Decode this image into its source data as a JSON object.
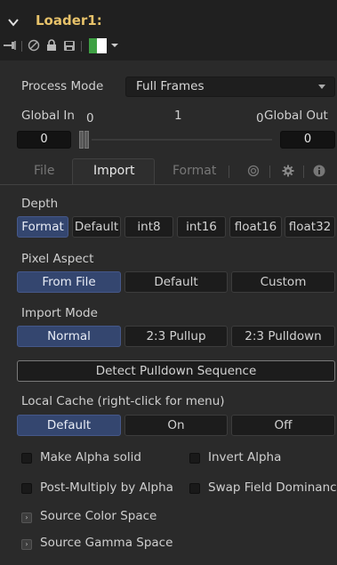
{
  "header": {
    "title": "Loader1:",
    "tools": [
      "pin-icon",
      "disable-icon",
      "lock-icon",
      "save-icon",
      "color-swatch-icon",
      "dropdown-caret-icon"
    ],
    "swatch_colors": [
      "#3ea043",
      "#ffffff"
    ]
  },
  "process_mode": {
    "label": "Process Mode",
    "value": "Full Frames"
  },
  "global_range": {
    "in_label": "Global In",
    "in_value": "0",
    "mid_value": "1",
    "out_left_value": "0",
    "out_label": "Global Out",
    "in_field": "0",
    "out_field": "0"
  },
  "tabs": {
    "file": "File",
    "import": "Import",
    "format": "Format",
    "icons": [
      "channels-icon",
      "gear-icon",
      "info-icon"
    ]
  },
  "depth": {
    "label": "Depth",
    "options": [
      "Format",
      "Default",
      "int8",
      "int16",
      "float16",
      "float32"
    ],
    "selected": "Format"
  },
  "pixel_aspect": {
    "label": "Pixel Aspect",
    "options": [
      "From File",
      "Default",
      "Custom"
    ],
    "selected": "From File"
  },
  "import_mode": {
    "label": "Import Mode",
    "options": [
      "Normal",
      "2:3 Pullup",
      "2:3 Pulldown"
    ],
    "selected": "Normal"
  },
  "detect_pulldown": {
    "label": "Detect Pulldown Sequence"
  },
  "local_cache": {
    "label": "Local Cache (right-click for menu)",
    "options": [
      "Default",
      "On",
      "Off"
    ],
    "selected": "Default"
  },
  "checkboxes": {
    "make_alpha_solid": "Make Alpha solid",
    "invert_alpha": "Invert Alpha",
    "post_multiply": "Post-Multiply by Alpha",
    "swap_field": "Swap Field Dominance"
  },
  "sections": {
    "source_color_space": "Source Color Space",
    "source_gamma_space": "Source Gamma Space"
  },
  "colors": {
    "accent": "#e7c26a",
    "selected": "#34466f"
  }
}
